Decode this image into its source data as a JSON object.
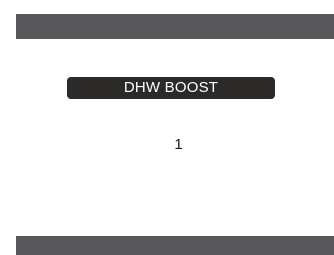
{
  "screen": {
    "title": "DHW BOOST",
    "value": "1"
  },
  "colors": {
    "bar": "#58585a",
    "pill": "#2b2a29",
    "pill_text": "#ffffff",
    "background": "#ffffff"
  }
}
